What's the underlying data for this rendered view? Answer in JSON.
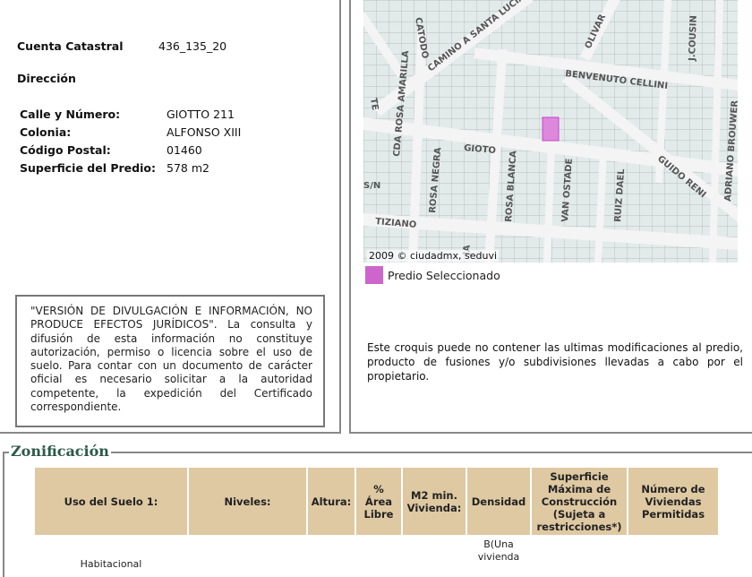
{
  "predio": {
    "cuenta_label": "Cuenta Catastral",
    "cuenta_value": "436_135_20",
    "direccion_label": "Dirección",
    "fields": [
      {
        "label": "Calle y Número:",
        "value": "GIOTTO 211"
      },
      {
        "label": "Colonia:",
        "value": "ALFONSO XIII"
      },
      {
        "label": "Código Postal:",
        "value": "01460"
      },
      {
        "label": "Superficie del Predio:",
        "value": "578 m2"
      }
    ]
  },
  "notice": "\"VERSIÓN DE DIVULGACIÓN E INFORMACIÓN, NO PRODUCE EFECTOS JURÍDICOS\". La consulta y difusión de esta información no constituye autorización, permiso o licencia sobre el uso de suelo. Para contar con un documento de carácter oficial es necesario solicitar a la autoridad competente, la expedición del Certificado correspondiente.",
  "map": {
    "credit": "2009 © ciudadmx, seduvi",
    "legend_label": "Predio Seleccionado",
    "legend_color": "#cc66cc",
    "streets": [
      "CATODO",
      "CAMINO A SANTA LUCIA",
      "OLIVAR",
      "J.COUSIN",
      "BENVENUTO CELLINI",
      "CDA ROSA AMARILLA",
      "GIOTO",
      "ROSA NEGRA",
      "ROSA BLANCA",
      "VAN OSTADE",
      "RUIZ DAEL",
      "GUIDO RENI",
      "ADRIANO BROUWER",
      "TIZIANO",
      "S/N",
      "TE",
      "JA"
    ]
  },
  "croquis_note": "Este croquis puede no contener las ultimas modificaciones al predio, producto de fusiones y/o subdivisiones llevadas a cabo por el propietario.",
  "zonificacion": {
    "title": "Zonificación",
    "headers": [
      "Uso del Suelo 1:",
      "Niveles:",
      "Altura:",
      "% Área Libre",
      "M2 min. Vivienda:",
      "Densidad",
      "Superficie Máxima de Construcción (Sujeta a restricciones*)",
      "Número de Viviendas Permitidas"
    ],
    "row": [
      "Habitacional",
      "",
      "",
      "",
      "",
      "B(Una vivienda",
      "",
      ""
    ]
  }
}
